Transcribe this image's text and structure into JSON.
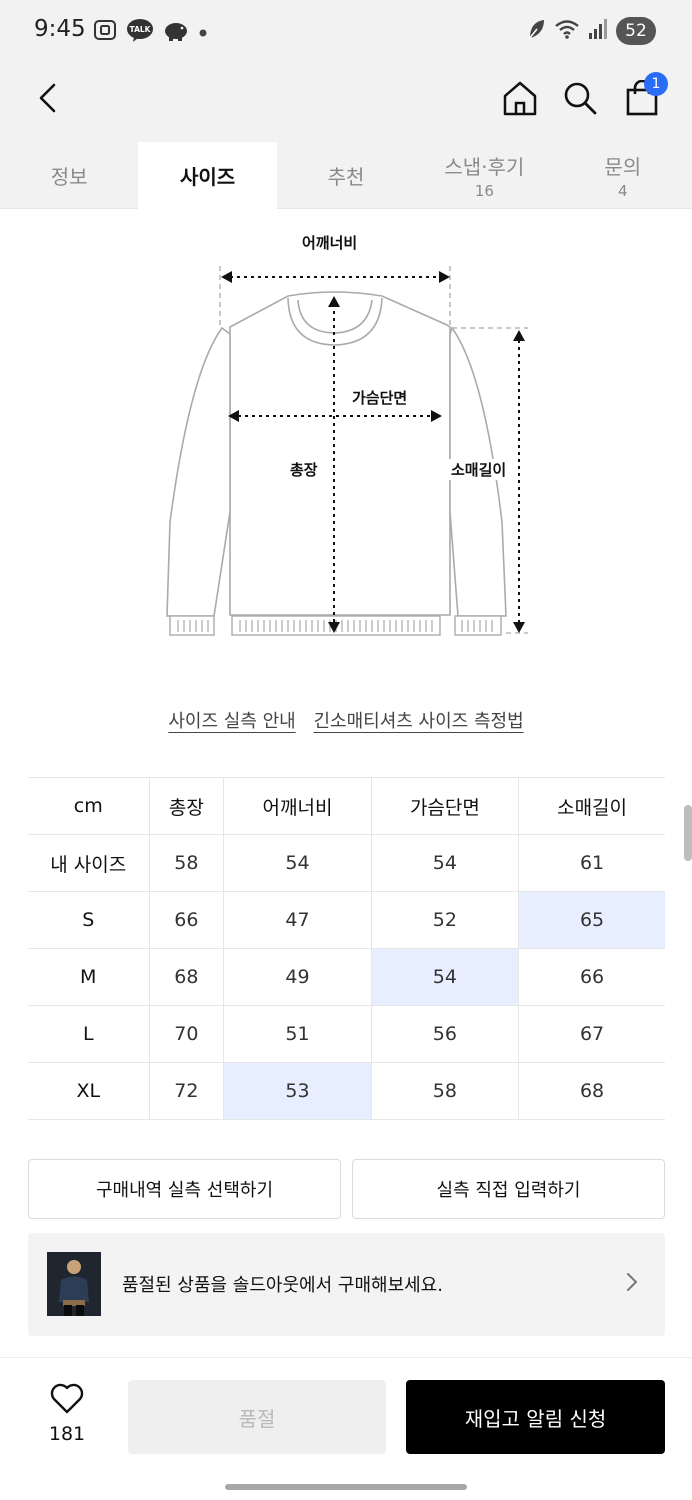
{
  "status_bar": {
    "time": "9:45",
    "left_icons": [
      "screenshot-icon",
      "kakaotalk-icon",
      "piggy-bank-icon",
      "dot-icon"
    ],
    "kakao_badge": "TALK",
    "right_icons": [
      "leaf-icon",
      "wifi-icon",
      "signal-icon"
    ],
    "battery": "52"
  },
  "header": {
    "cart_count": "1"
  },
  "tabs": [
    {
      "label": "정보",
      "count": "",
      "active": false
    },
    {
      "label": "사이즈",
      "count": "",
      "active": true
    },
    {
      "label": "추천",
      "count": "",
      "active": false
    },
    {
      "label": "스냅·후기",
      "count": "16",
      "active": false
    },
    {
      "label": "문의",
      "count": "4",
      "active": false
    }
  ],
  "diagram": {
    "shoulder": "어깨너비",
    "chest": "가슴단면",
    "length": "총장",
    "sleeve": "소매길이"
  },
  "links": {
    "guide": "사이즈 실측 안내",
    "method": "긴소매티셔츠 사이즈 측정법"
  },
  "size_table": {
    "headers": [
      "cm",
      "총장",
      "어깨너비",
      "가슴단면",
      "소매길이"
    ],
    "rows": [
      {
        "label": "내 사이즈",
        "values": [
          "58",
          "54",
          "54",
          "61"
        ],
        "highlight": [
          false,
          false,
          false,
          false
        ]
      },
      {
        "label": "S",
        "values": [
          "66",
          "47",
          "52",
          "65"
        ],
        "highlight": [
          false,
          false,
          false,
          true
        ]
      },
      {
        "label": "M",
        "values": [
          "68",
          "49",
          "54",
          "66"
        ],
        "highlight": [
          false,
          false,
          true,
          false
        ]
      },
      {
        "label": "L",
        "values": [
          "70",
          "51",
          "56",
          "67"
        ],
        "highlight": [
          false,
          false,
          false,
          false
        ]
      },
      {
        "label": "XL",
        "values": [
          "72",
          "53",
          "58",
          "68"
        ],
        "highlight": [
          false,
          true,
          false,
          false
        ]
      }
    ]
  },
  "actions": {
    "select_history": "구매내역 실측 선택하기",
    "manual_input": "실측 직접 입력하기"
  },
  "banner": {
    "text": "품절된 상품을 솔드아웃에서 구매해보세요."
  },
  "bottom_bar": {
    "like_count": "181",
    "soldout_label": "품절",
    "restock_label": "재입고 알림 신청"
  },
  "colors": {
    "highlight": "#e6eeff",
    "badge": "#2b6cf6",
    "primary_button": "#000000"
  }
}
